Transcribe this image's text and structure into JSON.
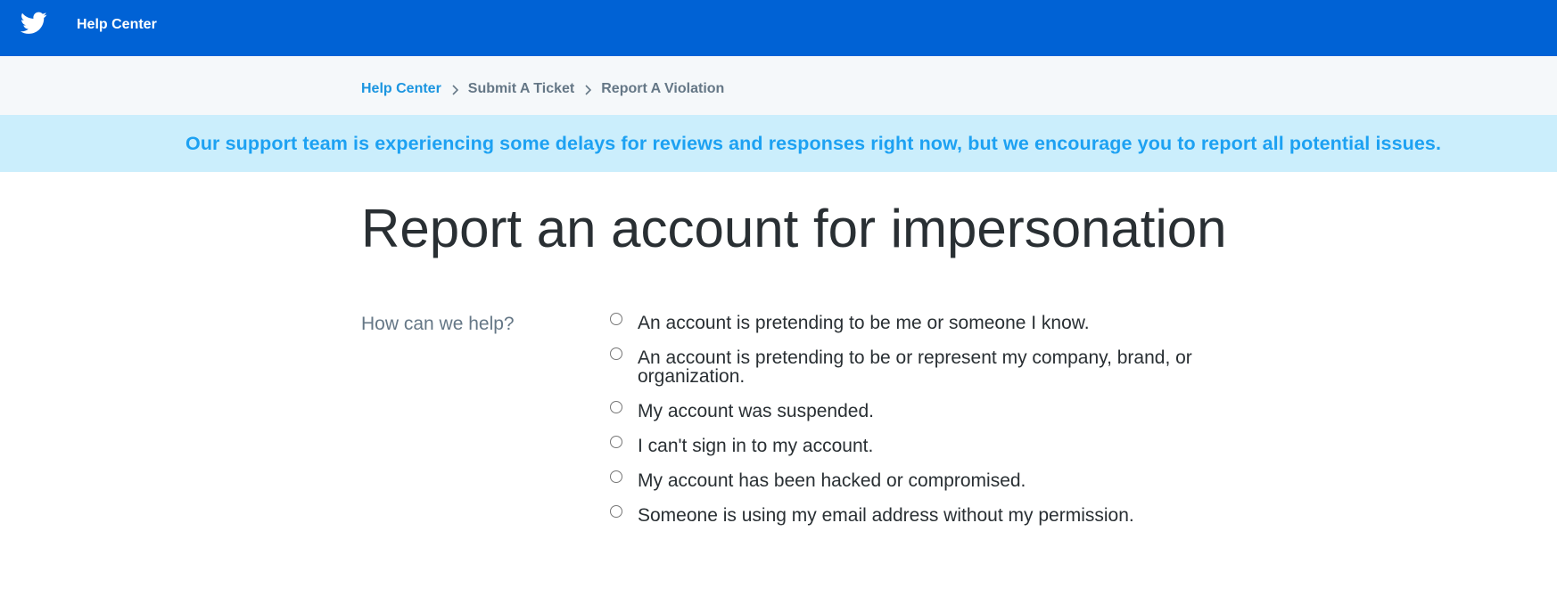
{
  "header": {
    "brand": "Help Center",
    "logo_icon": "twitter-bird-icon",
    "bar_color": "#0062d5"
  },
  "breadcrumb": {
    "items": [
      {
        "label": "Help Center",
        "link": true
      },
      {
        "label": "Submit A Ticket",
        "link": false
      },
      {
        "label": "Report A Violation",
        "link": false
      }
    ],
    "separator_icon": "chevron-right-icon"
  },
  "notice": {
    "text": "Our support team is experiencing some delays for reviews and responses right now, but we encourage you to report all potential issues.",
    "background": "#cbeefc",
    "text_color": "#1da1f2"
  },
  "page": {
    "title": "Report an account for impersonation"
  },
  "form": {
    "question_label": "How can we help?",
    "selected": null,
    "options": [
      {
        "label": "An account is pretending to be me or someone I know."
      },
      {
        "label": "An account is pretending to be or represent my company, brand, or organization."
      },
      {
        "label": "My account was suspended."
      },
      {
        "label": "I can't sign in to my account."
      },
      {
        "label": "My account has been hacked or compromised."
      },
      {
        "label": "Someone is using my email address without my permission."
      }
    ]
  }
}
